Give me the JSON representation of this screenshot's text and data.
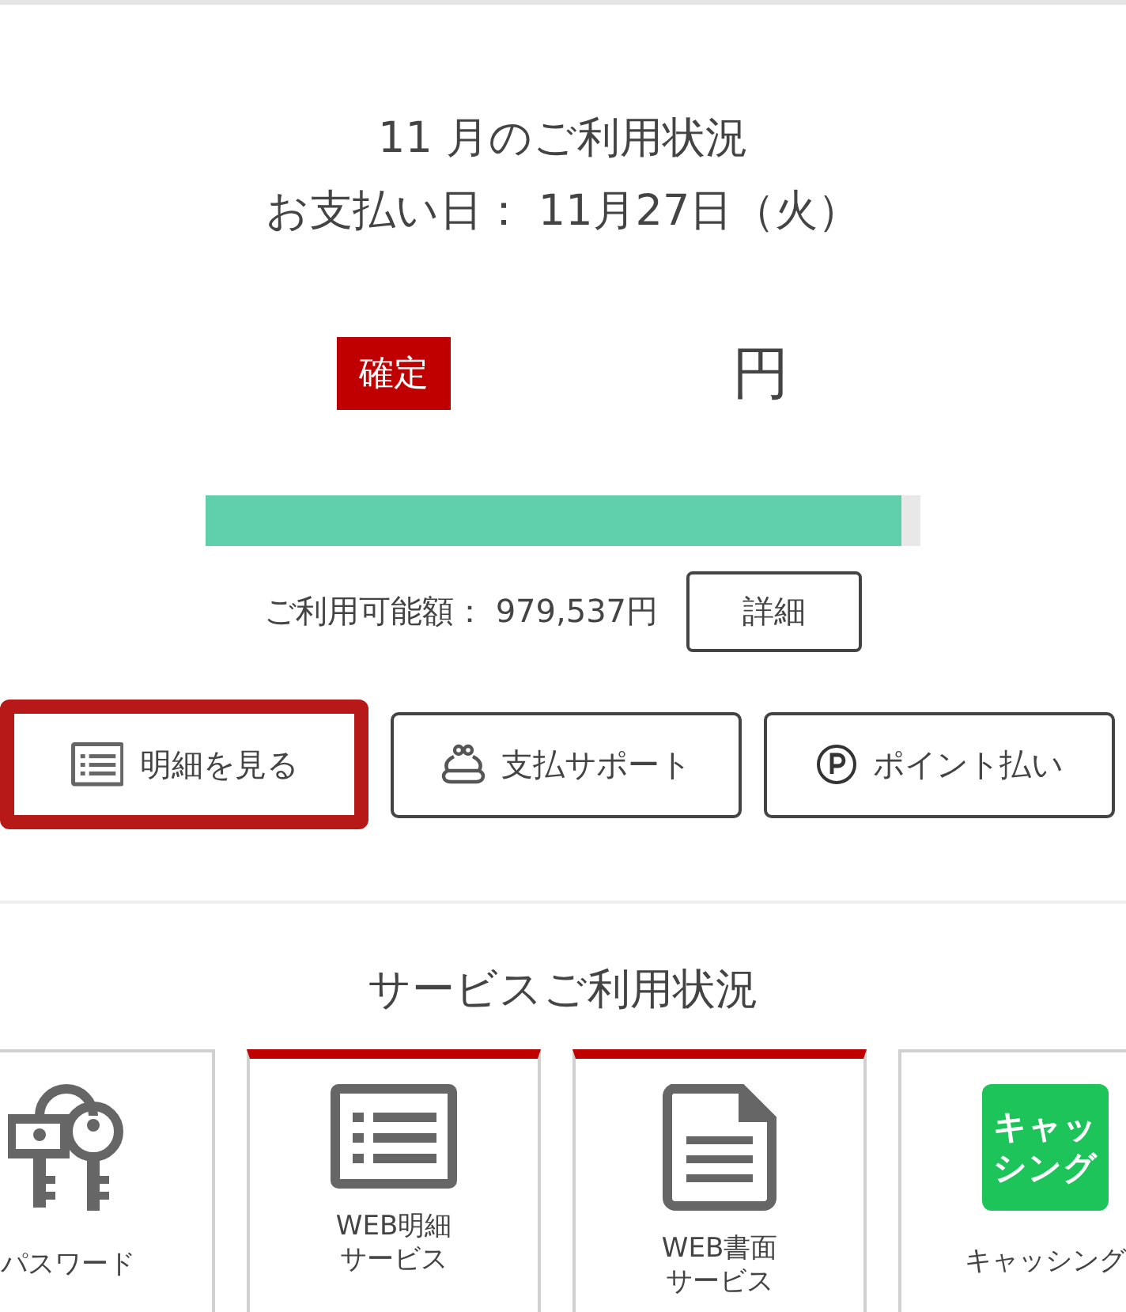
{
  "header": {
    "title": "11 月のご利用状況",
    "due_date": "お支払い日： 11月27日（火）"
  },
  "amount": {
    "badge": "確定",
    "unit": "円"
  },
  "usage": {
    "level": 0.973,
    "available": "ご利用可能額： 979,537円",
    "detail_button": "詳細"
  },
  "actions": [
    {
      "label": "明細を見る",
      "kind": "statement",
      "selected": true
    },
    {
      "label": "支払サポート",
      "kind": "support",
      "selected": false
    },
    {
      "label": "ポイント払い",
      "kind": "points",
      "selected": false
    }
  ],
  "services": {
    "title": "サービスご利用状況",
    "cards": [
      {
        "kind": "keys",
        "label": "パスワード",
        "highlighted": false
      },
      {
        "kind": "list",
        "label": "WEB明細サービス",
        "highlighted": true
      },
      {
        "kind": "document",
        "label": "WEB書面サービス",
        "highlighted": true
      },
      {
        "kind": "logo",
        "logo_text": "キャッシング",
        "label": "キャッシング",
        "highlighted": false
      }
    ]
  }
}
